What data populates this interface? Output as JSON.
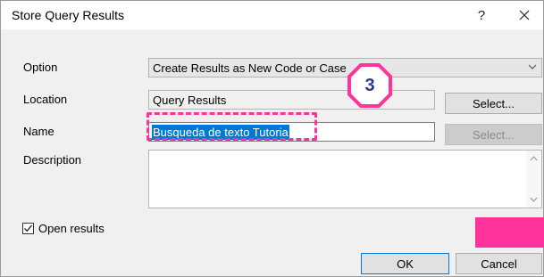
{
  "window": {
    "title": "Store Query Results",
    "help_label": "?"
  },
  "form": {
    "option": {
      "label": "Option",
      "value": "Create Results as New Code or Case"
    },
    "location": {
      "label": "Location",
      "value": "Query Results",
      "select_button": "Select..."
    },
    "name": {
      "label": "Name",
      "value": "Busqueda de texto Tutoria",
      "select_button": "Select..."
    },
    "description": {
      "label": "Description",
      "value": ""
    },
    "open_results": {
      "label": "Open results",
      "checked": true
    }
  },
  "buttons": {
    "ok": "OK",
    "cancel": "Cancel"
  },
  "annotation": {
    "step_number": "3",
    "color": "#ff3399",
    "badge_text_color": "#2b3b86"
  },
  "colors": {
    "selection": "#0078d7",
    "dialog_bg": "#f0f0f0"
  }
}
